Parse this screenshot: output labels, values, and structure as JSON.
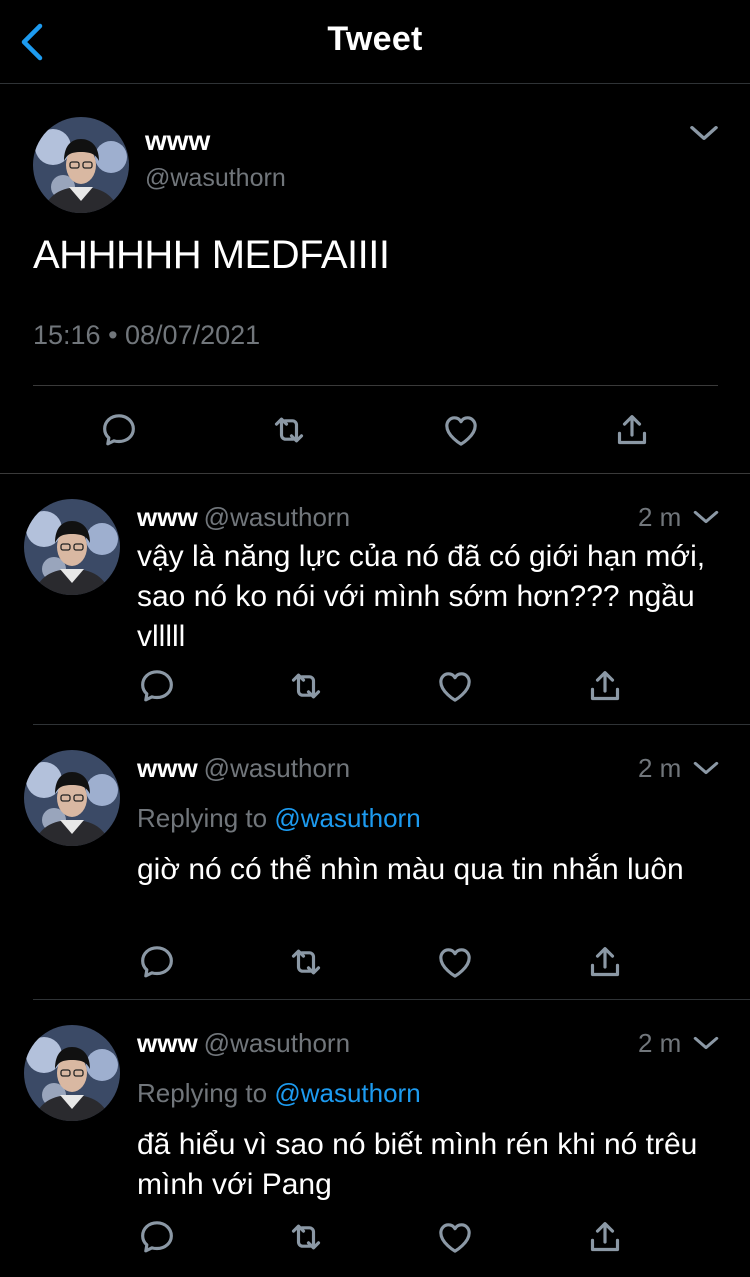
{
  "nav": {
    "title": "Tweet"
  },
  "main_tweet": {
    "name": "www",
    "handle": "@wasuthorn",
    "text": "AHHHHH MEDFAIIII",
    "timestamp": "15:16 • 08/07/2021"
  },
  "replies": [
    {
      "name": "www",
      "handle": "@wasuthorn",
      "time": "2 m",
      "text": "vậy là năng lực của nó đã có giới hạn mới, sao nó ko nói với mình sớm hơn??? ngầu vlllll"
    },
    {
      "name": "www",
      "handle": "@wasuthorn",
      "time": "2 m",
      "replying_prefix": "Replying to",
      "replying_to": "@wasuthorn",
      "text": "giờ nó có thể nhìn màu qua tin nhắn luôn"
    },
    {
      "name": "www",
      "handle": "@wasuthorn",
      "time": "2 m",
      "replying_prefix": "Replying to",
      "replying_to": "@wasuthorn",
      "text": "đã hiểu vì sao nó biết mình rén khi nó trêu mình với Pang"
    }
  ],
  "colors": {
    "background": "#000000",
    "accent": "#1d9bf0",
    "secondary_text": "#71767b"
  },
  "icons": [
    "back-icon",
    "chevron-down-icon",
    "reply-icon",
    "retweet-icon",
    "like-icon",
    "share-icon"
  ]
}
